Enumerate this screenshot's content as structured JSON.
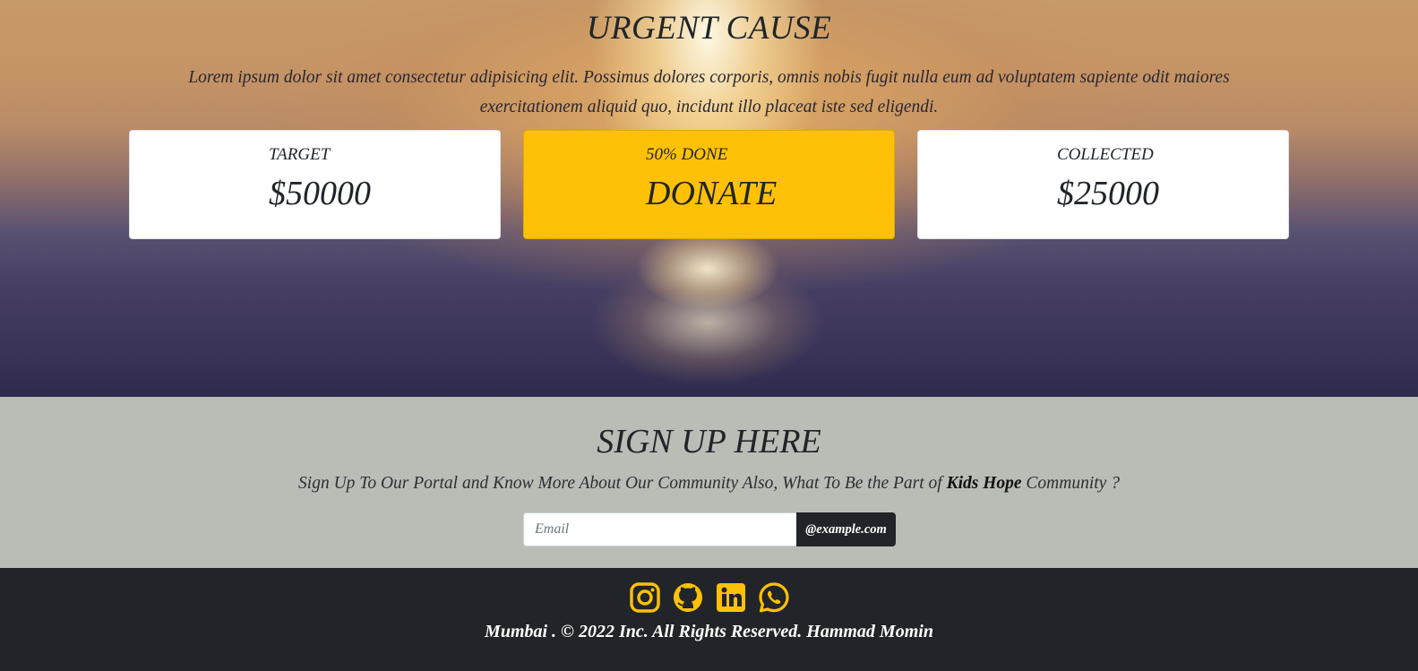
{
  "urgent_cause": {
    "title": "URGENT CAUSE",
    "description": "Lorem ipsum dolor sit amet consectetur adipisicing elit. Possimus dolores corporis, omnis nobis fugit nulla eum ad voluptatem sapiente odit maiores exercitationem aliquid quo, incidunt illo placeat iste sed eligendi.",
    "cards": {
      "target": {
        "label": "TARGET",
        "value": "$50000"
      },
      "donate": {
        "label": "50% DONE",
        "value": "DONATE"
      },
      "collected": {
        "label": "COLLECTED",
        "value": "$25000"
      }
    }
  },
  "signup": {
    "title": "SIGN UP HERE",
    "text_before": "Sign Up To Our Portal and Know More About Our Community Also, What To Be the Part of ",
    "brand": "Kids Hope",
    "text_after": " Community ?",
    "email_placeholder": "Email",
    "email_addon": "@example.com"
  },
  "footer": {
    "social_icons": [
      "instagram-icon",
      "github-icon",
      "linkedin-icon",
      "whatsapp-icon"
    ],
    "icon_color": "#ffc107",
    "copyright": "Mumbai . © 2022 Inc. All Rights Reserved. Hammad Momin"
  },
  "colors": {
    "accent": "#ffc107",
    "dark": "#212529",
    "signup_bg": "#babdb6"
  }
}
